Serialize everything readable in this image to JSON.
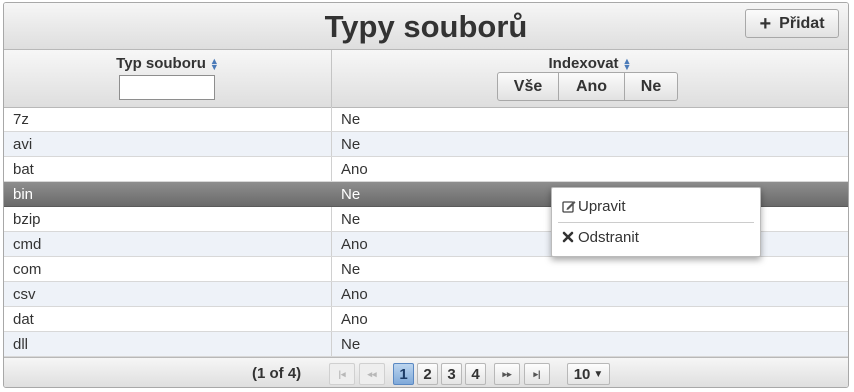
{
  "title": "Typy souborů",
  "toolbar": {
    "add_label": "Přidat"
  },
  "columns": {
    "type_header": "Typ souboru",
    "index_header": "Indexovat"
  },
  "filter": {
    "type_value": ""
  },
  "index_filter": {
    "all": "Vše",
    "yes": "Ano",
    "no": "Ne"
  },
  "rows": [
    {
      "type": "7z",
      "index": "Ne"
    },
    {
      "type": "avi",
      "index": "Ne"
    },
    {
      "type": "bat",
      "index": "Ano"
    },
    {
      "type": "bin",
      "index": "Ne",
      "selected": true
    },
    {
      "type": "bzip",
      "index": "Ne"
    },
    {
      "type": "cmd",
      "index": "Ano"
    },
    {
      "type": "com",
      "index": "Ne"
    },
    {
      "type": "csv",
      "index": "Ano"
    },
    {
      "type": "dat",
      "index": "Ano"
    },
    {
      "type": "dll",
      "index": "Ne"
    }
  ],
  "pagination": {
    "info": "(1 of 4)",
    "pages": [
      "1",
      "2",
      "3",
      "4"
    ],
    "current_page": "1",
    "rows_per_page": "10"
  },
  "context_menu": {
    "edit_label": "Upravit",
    "delete_label": "Odstranit"
  },
  "colors": {
    "selected_row": "#7a7a7a",
    "active_page": "#8fb4de",
    "alt_row": "#eef2f8"
  }
}
